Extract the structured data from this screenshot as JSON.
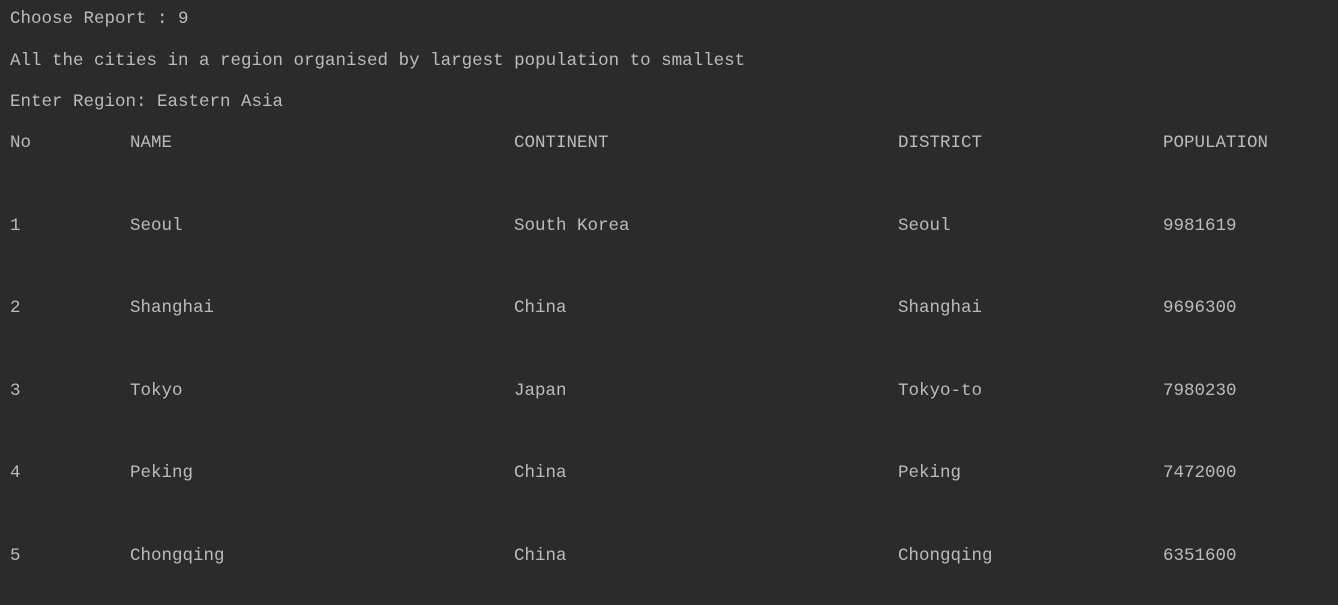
{
  "console": {
    "prompt_line": "Choose Report : 9",
    "description": "All the cities in a region organised by largest population to smallest",
    "region_line": "Enter Region: Eastern Asia"
  },
  "table": {
    "headers": {
      "no": "No",
      "name": "NAME",
      "continent": "CONTINENT",
      "district": "DISTRICT",
      "population": "POPULATION"
    },
    "rows": [
      {
        "no": "1",
        "name": "Seoul",
        "continent": "South Korea",
        "district": "Seoul",
        "population": "9981619"
      },
      {
        "no": "2",
        "name": "Shanghai",
        "continent": "China",
        "district": "Shanghai",
        "population": "9696300"
      },
      {
        "no": "3",
        "name": "Tokyo",
        "continent": "Japan",
        "district": "Tokyo-to",
        "population": "7980230"
      },
      {
        "no": "4",
        "name": "Peking",
        "continent": "China",
        "district": "Peking",
        "population": "7472000"
      },
      {
        "no": "5",
        "name": "Chongqing",
        "continent": "China",
        "district": "Chongqing",
        "population": "6351600"
      }
    ]
  }
}
